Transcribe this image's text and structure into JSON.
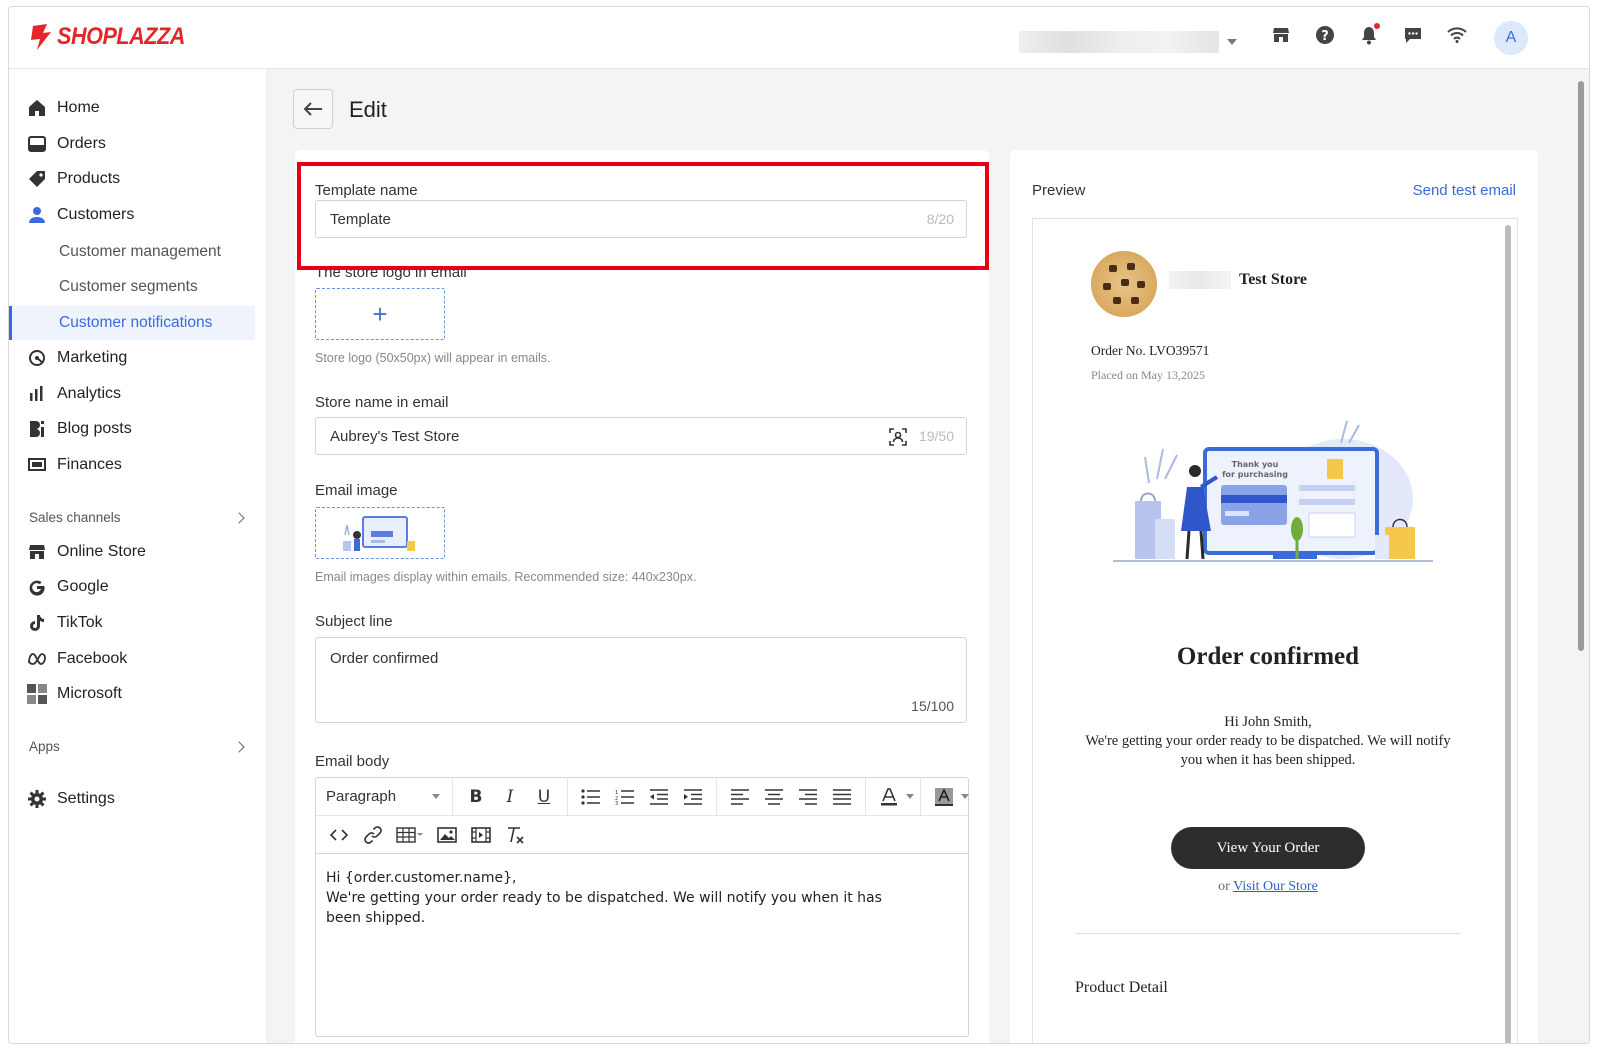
{
  "brand": {
    "name": "SHOPLAZZA",
    "accent": "#e4262b",
    "link": "#3a6bd9"
  },
  "topbar": {
    "avatar_initial": "A",
    "icons": [
      "store-icon",
      "help-icon",
      "bell-icon",
      "chat-icon",
      "wifi-icon"
    ]
  },
  "sidebar": {
    "items": [
      {
        "label": "Home",
        "icon": "home-icon"
      },
      {
        "label": "Orders",
        "icon": "orders-icon"
      },
      {
        "label": "Products",
        "icon": "tag-icon"
      },
      {
        "label": "Customers",
        "icon": "person-icon"
      }
    ],
    "customer_subitems": [
      "Customer management",
      "Customer segments",
      "Customer notifications"
    ],
    "items2": [
      {
        "label": "Marketing",
        "icon": "marketing-icon"
      },
      {
        "label": "Analytics",
        "icon": "analytics-icon"
      },
      {
        "label": "Blog posts",
        "icon": "blog-icon"
      },
      {
        "label": "Finances",
        "icon": "finances-icon"
      }
    ],
    "sales_channels_label": "Sales channels",
    "channels": [
      {
        "label": "Online Store",
        "icon": "store-icon"
      },
      {
        "label": "Google",
        "icon": "google-icon"
      },
      {
        "label": "TikTok",
        "icon": "tiktok-icon"
      },
      {
        "label": "Facebook",
        "icon": "meta-icon"
      },
      {
        "label": "Microsoft",
        "icon": "microsoft-icon"
      }
    ],
    "apps_label": "Apps",
    "settings_label": "Settings"
  },
  "page": {
    "title": "Edit"
  },
  "form": {
    "template_name_label": "Template name",
    "template_name_value": "Template",
    "template_name_counter": "8/20",
    "logo_label": "The store logo in email",
    "logo_hint": "Store logo (50x50px) will appear in emails.",
    "store_name_label": "Store name in email",
    "store_name_value": "Aubrey's Test Store",
    "store_name_counter": "19/50",
    "email_image_label": "Email image",
    "email_image_hint": "Email images display within emails. Recommended size: 440x230px.",
    "subject_label": "Subject line",
    "subject_value": "Order confirmed",
    "subject_counter": "15/100",
    "body_label": "Email body",
    "paragraph_label": "Paragraph",
    "body_lines": [
      "Hi {order.customer.name},",
      "We're getting your order ready to be dispatched. We will notify you when it has",
      "been shipped."
    ]
  },
  "preview": {
    "title": "Preview",
    "send_test": "Send test email",
    "store_name": "Test Store",
    "order_no": "Order No. LVO39571",
    "placed_on": "Placed on May 13,2025",
    "illustration_text_1": "Thank you",
    "illustration_text_2": "for purchasing",
    "heading": "Order confirmed",
    "greeting": "Hi John Smith,",
    "message": "We're getting your order ready to be dispatched. We will notify you when it has been shipped.",
    "button": "View Your Order",
    "or_text": "or",
    "visit_link": "Visit Our Store",
    "product_detail": "Product Detail"
  }
}
